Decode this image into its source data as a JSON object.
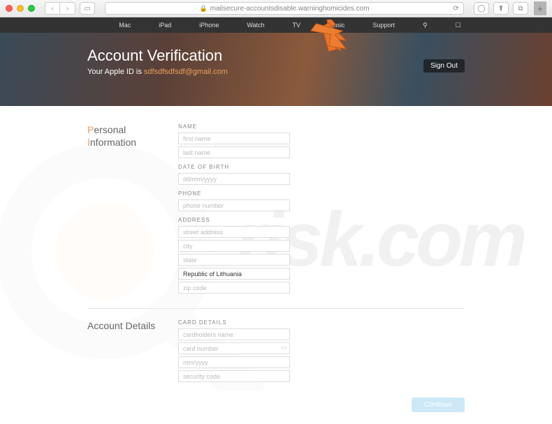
{
  "browser": {
    "url": "mailsecure-accountsdisable.warninghomicides.com"
  },
  "nav": {
    "items": [
      "Mac",
      "iPad",
      "iPhone",
      "Watch",
      "TV",
      "Music",
      "Support"
    ]
  },
  "hero": {
    "title": "Account Verification",
    "subtitle_prefix": "Your Apple ID is ",
    "email": "sdfsdfsdfsdf@gmail.com",
    "sign_out": "Sign Out"
  },
  "sections": {
    "personal": {
      "label_p": "P",
      "label_ersonal": "ersonal",
      "label_i": "I",
      "label_nformation": "nformation"
    },
    "account": {
      "label": "Account Details"
    }
  },
  "labels": {
    "name": "NAME",
    "dob": "DATE OF BIRTH",
    "phone": "PHONE",
    "address": "ADDRESS",
    "card": "CARD DETAILS"
  },
  "placeholders": {
    "first_name": "first name",
    "last_name": "last name",
    "dob": "dd/mm/yyyy",
    "phone": "phone number",
    "street": "street address",
    "city": "city",
    "state": "state",
    "zip": "zip code",
    "cardholder": "cardholders name",
    "card_number": "card number",
    "expiry": "mm/yyyy",
    "cvv": "security code"
  },
  "values": {
    "country": "Republic of Lithuania"
  },
  "buttons": {
    "continue": "Continue"
  },
  "watermark": {
    "text": "risk.com"
  }
}
